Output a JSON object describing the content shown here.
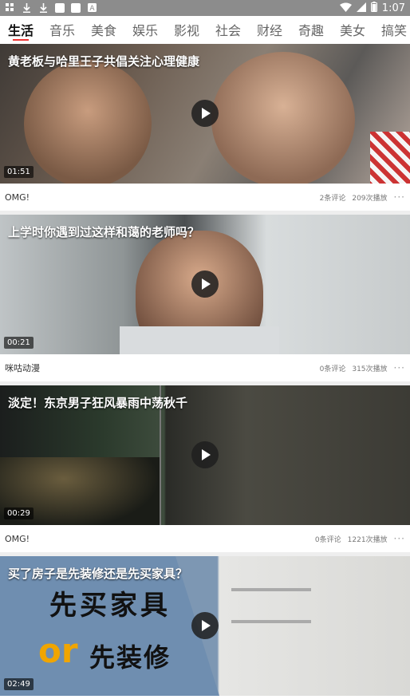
{
  "status_bar": {
    "time": "1:07",
    "notification_icons": [
      "notification-icon",
      "download-icon",
      "download-icon",
      "app-icon",
      "app-icon",
      "a-icon"
    ],
    "system_icons": [
      "wifi-icon",
      "signal-icon",
      "battery-icon"
    ]
  },
  "tabs": [
    {
      "label": "生活",
      "active": true
    },
    {
      "label": "音乐"
    },
    {
      "label": "美食"
    },
    {
      "label": "娱乐"
    },
    {
      "label": "影视"
    },
    {
      "label": "社会"
    },
    {
      "label": "财经"
    },
    {
      "label": "奇趣"
    },
    {
      "label": "美女"
    },
    {
      "label": "搞笑"
    }
  ],
  "videos": [
    {
      "title": "黄老板与哈里王子共倡关注心理健康",
      "duration": "01:51",
      "source": "OMG!",
      "comments": "2条评论",
      "plays": "209次播放"
    },
    {
      "title": "上学时你遇到过这样和蔼的老师吗？",
      "duration": "00:21",
      "source": "咪咕动漫",
      "comments": "0条评论",
      "plays": "315次播放"
    },
    {
      "title": "淡定！东京男子狂风暴雨中荡秋千",
      "duration": "00:29",
      "source": "OMG!",
      "comments": "0条评论",
      "plays": "1221次播放"
    },
    {
      "title": "买了房子是先装修还是先买家具？",
      "duration": "02:49",
      "thumb_text_1": "先买家具",
      "thumb_text_or": "or",
      "thumb_text_2": "先装修"
    }
  ],
  "more_label": "···",
  "colors": {
    "accent": "#e33333",
    "status_bar": "#8c8c8c",
    "separator": "#eeeeee"
  }
}
